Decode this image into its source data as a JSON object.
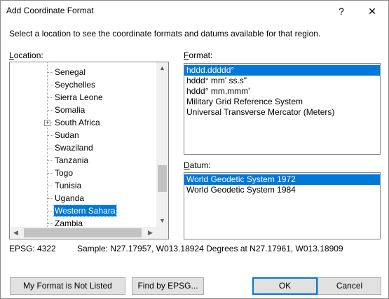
{
  "window": {
    "title": "Add Coordinate Format",
    "help_glyph": "?",
    "close_glyph": "✕"
  },
  "instructions": "Select a location to see the coordinate formats and datums available for that region.",
  "location": {
    "label_mnemonic": "L",
    "label_rest": "ocation:",
    "items": [
      {
        "label": "Senegal"
      },
      {
        "label": "Seychelles"
      },
      {
        "label": "Sierra Leone"
      },
      {
        "label": "Somalia"
      },
      {
        "label": "South Africa",
        "expandable": true
      },
      {
        "label": "Sudan"
      },
      {
        "label": "Swaziland"
      },
      {
        "label": "Tanzania"
      },
      {
        "label": "Togo"
      },
      {
        "label": "Tunisia"
      },
      {
        "label": "Uganda"
      },
      {
        "label": "Western Sahara",
        "selected": true
      },
      {
        "label": "Zambia"
      }
    ],
    "scroll_up": "▲",
    "scroll_down": "▼",
    "scroll_left": "◀",
    "scroll_right": "▶",
    "expander_glyph": "+"
  },
  "format": {
    "label_mnemonic": "F",
    "label_rest": "ormat:",
    "items": [
      {
        "label": "hddd.ddddd°",
        "selected": true
      },
      {
        "label": "hddd° mm' ss.s\""
      },
      {
        "label": "hddd° mm.mmm'"
      },
      {
        "label": "Military Grid Reference System"
      },
      {
        "label": "Universal Transverse Mercator (Meters)"
      }
    ]
  },
  "datum": {
    "label_mnemonic": "D",
    "label_rest": "atum:",
    "items": [
      {
        "label": "World Geodetic System 1972",
        "selected": true
      },
      {
        "label": "World Geodetic System 1984"
      }
    ]
  },
  "status": {
    "epsg": "EPSG: 4322",
    "sample": "Sample: N27.17957, W013.18924 Degrees at N27.17961, W013.18909"
  },
  "buttons": {
    "not_listed": "My Format is Not Listed",
    "find_epsg": "Find by EPSG...",
    "ok": "OK",
    "cancel": "Cancel"
  },
  "colors": {
    "selection": "#0078d7",
    "button_face": "#e1e1e1",
    "scrollbar_track": "#f0f0f0",
    "scrollbar_thumb": "#c2c2c2"
  }
}
